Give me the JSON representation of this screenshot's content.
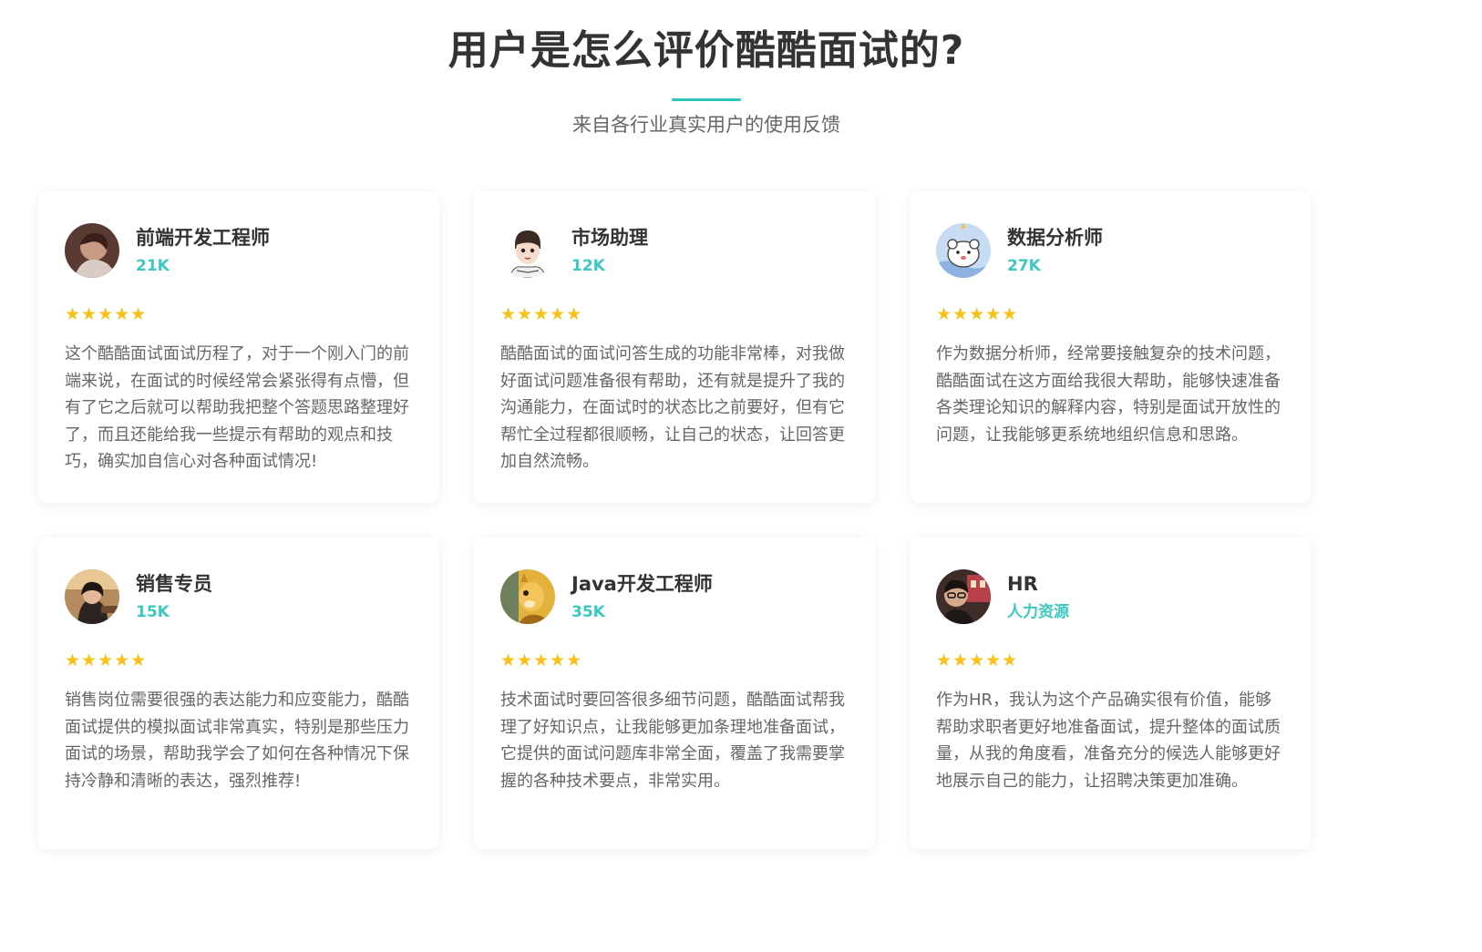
{
  "header": {
    "title": "用户是怎么评价酷酷面试的?",
    "subtitle": "来自各行业真实用户的使用反馈"
  },
  "colors": {
    "accent": "#3cc8c0",
    "star": "#f6c21a",
    "title": "#333333",
    "body_text": "#666666"
  },
  "reviews": [
    {
      "role": "前端开发工程师",
      "count": "21K",
      "stars": "★★★★★",
      "text": "这个酷酷面试面试历程了，对于一个刚入门的前端来说，在面试的时候经常会紧张得有点懵，但有了它之后就可以帮助我把整个答题思路整理好了，而且还能给我一些提示有帮助的观点和技巧，确实加自信心对各种面试情况!",
      "avatar": "portrait-photo"
    },
    {
      "role": "市场助理",
      "count": "12K",
      "stars": "★★★★★",
      "text": "酷酷面试的面试问答生成的功能非常棒，对我做好面试问题准备很有帮助，还有就是提升了我的沟通能力，在面试时的状态比之前要好，但有它帮忙全过程都很顺畅，让自己的状态，让回答更加自然流畅。",
      "avatar": "cartoon-boy"
    },
    {
      "role": "数据分析师",
      "count": "27K",
      "stars": "★★★★★",
      "text": "作为数据分析师，经常要接触复杂的技术问题，酷酷面试在这方面给我很大帮助，能够快速准备各类理论知识的解释内容，特别是面试开放性的问题，让我能够更系统地组织信息和思路。",
      "avatar": "cartoon-bear"
    },
    {
      "role": "销售专员",
      "count": "15K",
      "stars": "★★★★★",
      "text": "销售岗位需要很强的表达能力和应变能力，酷酷面试提供的模拟面试非常真实，特别是那些压力面试的场景，帮助我学会了如何在各种情况下保持冷静和清晰的表达，强烈推荐!",
      "avatar": "portrait-photo"
    },
    {
      "role": "Java开发工程师",
      "count": "35K",
      "stars": "★★★★★",
      "text": "技术面试时要回答很多细节问题，酷酷面试帮我理了好知识点，让我能够更加条理地准备面试，它提供的面试问题库非常全面，覆盖了我需要掌握的各种技术要点，非常实用。",
      "avatar": "cartoon-animal"
    },
    {
      "role": "HR",
      "count": "人力资源",
      "stars": "★★★★★",
      "text": "作为HR，我认为这个产品确实很有价值，能够帮助求职者更好地准备面试，提升整体的面试质量，从我的角度看，准备充分的候选人能够更好地展示自己的能力，让招聘决策更加准确。",
      "avatar": "portrait-photo"
    }
  ]
}
